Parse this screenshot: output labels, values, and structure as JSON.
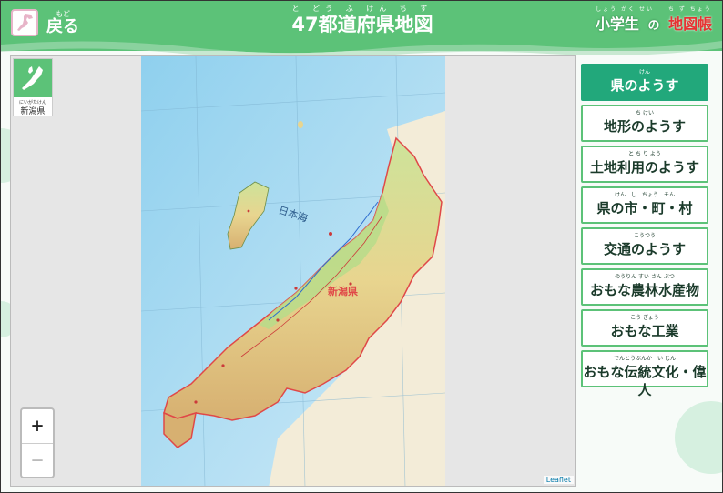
{
  "header": {
    "back_ruby": "もど",
    "back_label": "戻る",
    "title_ruby": "と どう ふ けん ち ず",
    "title": "47都道府県地図",
    "logo_ruby": "しょう がく せい　　ち ず ちょう",
    "logo_part1": "小学生",
    "logo_part2": "の",
    "logo_part3": "地図帳"
  },
  "map": {
    "prefecture_ruby": "にいがたけん",
    "prefecture_label": "新潟県",
    "zoom_in_label": "+",
    "zoom_out_label": "−",
    "attribution": "Leaflet",
    "sea_label": "日本海",
    "prefecture_map_label": "新潟県"
  },
  "menu": [
    {
      "ruby": "けん",
      "label": "県のようす",
      "active": true
    },
    {
      "ruby": "ち けい",
      "label": "地形のようす",
      "active": false
    },
    {
      "ruby": "と ち り よう",
      "label": "土地利用のようす",
      "active": false
    },
    {
      "ruby": "けん　し　ちょう　そん",
      "label": "県の市・町・村",
      "active": false
    },
    {
      "ruby": "こうつう",
      "label": "交通のようす",
      "active": false
    },
    {
      "ruby": "のうりん すい さん ぶつ",
      "label": "おもな農林水産物",
      "active": false
    },
    {
      "ruby": "こう ぎょう",
      "label": "おもな工業",
      "active": false
    },
    {
      "ruby": "でんとうぶんか　い じん",
      "label": "おもな伝統文化・偉人",
      "active": false
    }
  ],
  "colors": {
    "header_green": "#5cc278",
    "active_button": "#22a87b",
    "logo_red": "#e63333"
  }
}
